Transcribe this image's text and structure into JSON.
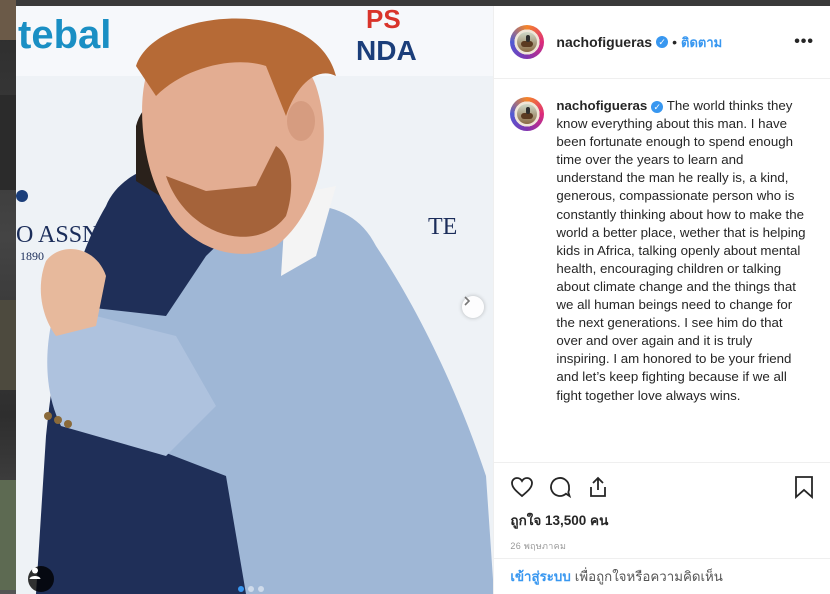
{
  "post": {
    "username": "nachofigueras",
    "verified_icon": "verified-badge-icon",
    "follow_label": "ติดตาม",
    "more_label": "•••",
    "caption": "The world thinks they know everything about this man. I have been fortunate enough to spend enough time over the years to learn and understand the man he really is, a kind, generous, compassionate person who is constantly thinking about how to make the world a better place, wether that is helping kids in Africa, talking openly about mental health, encouraging children or talking about climate change and the things that we all human beings need to change for the next generations. I see him do that over and over again and it is truly inspiring. I am honored to be your friend and let’s keep fighting because if we all fight together love always wins.",
    "likes": "ถูกใจ 13,500 คน",
    "date": "26 พฤษภาคม",
    "carousel_dots": 3,
    "active_dot": 0
  },
  "photo": {
    "banner_left": "tebal",
    "banner_right": "PS\nNDA",
    "sign_text": "O ASSN",
    "sign_year": "1890",
    "sign_right": "TE"
  },
  "footer": {
    "login_label": "เข้าสู่ระบบ",
    "login_rest": "เพื่อถูกใจหรือความคิดเห็น"
  },
  "colors": {
    "accent": "#3897f0",
    "text": "#262626",
    "muted": "#999999",
    "border": "#efefef"
  }
}
